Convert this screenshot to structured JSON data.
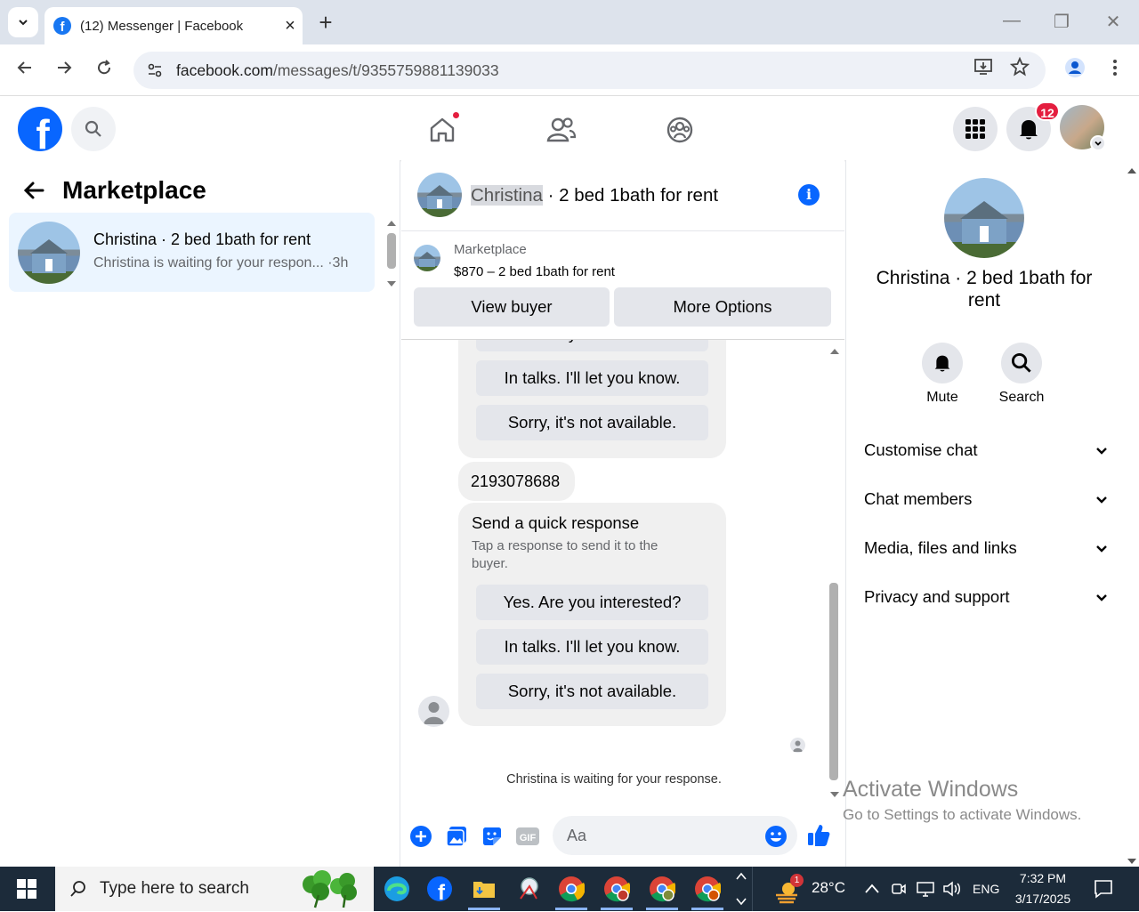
{
  "browser": {
    "tab_title": "(12) Messenger | Facebook",
    "url_main": "facebook.com",
    "url_rest": "/messages/t/9355759881139033"
  },
  "fb": {
    "notif_count": "12"
  },
  "left": {
    "title": "Marketplace",
    "conversation": {
      "name": "Christina · 2 bed 1bath for rent",
      "snippet": "Christina is waiting for your respon... ·3h"
    }
  },
  "chat": {
    "name": "Christina",
    "title_rest": " · 2 bed 1bath for rent",
    "card_label": "Marketplace",
    "card_price": "$870 – 2 bed 1bath for rent",
    "view_buyer": "View buyer",
    "more_options": "More Options",
    "partial_option": "Yes. Are you interested?",
    "messages": {
      "phone": "2193078688",
      "quick_title": "Send a quick response",
      "quick_sub": "Tap a response to send it to the buyer.",
      "options": [
        "Yes. Are you interested?",
        "In talks. I'll let you know.",
        "Sorry, it's not available."
      ]
    },
    "waiting": "Christina is waiting for your response.",
    "input_placeholder": "Aa"
  },
  "right": {
    "name": "Christina · 2 bed 1bath for rent",
    "mute": "Mute",
    "search": "Search",
    "sections": [
      "Customise chat",
      "Chat members",
      "Media, files and links",
      "Privacy and support"
    ]
  },
  "watermark": {
    "line1": "Activate Windows",
    "line2": "Go to Settings to activate Windows."
  },
  "taskbar": {
    "search_placeholder": "Type here to search",
    "weather_badge": "1",
    "temperature": "28°C",
    "language": "ENG",
    "time": "7:32 PM",
    "date": "3/17/2025"
  },
  "colors": {
    "fb_blue": "#0866ff",
    "badge_red": "#e41e3f",
    "selected_bg": "#ebf5ff",
    "taskbar_bg": "#1c2b3a"
  }
}
